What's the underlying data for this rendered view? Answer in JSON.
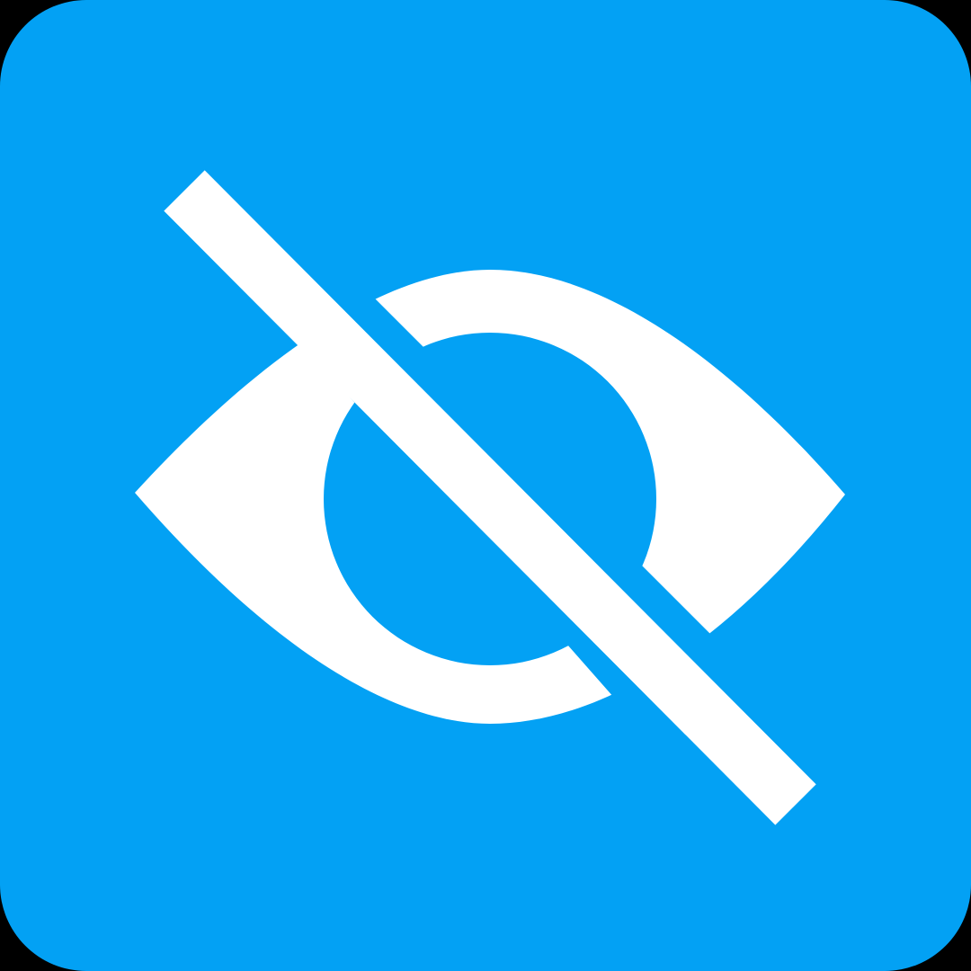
{
  "icon": {
    "name": "eye-off-icon",
    "background_color": "#03A1F4",
    "foreground_color": "#FFFFFF"
  }
}
